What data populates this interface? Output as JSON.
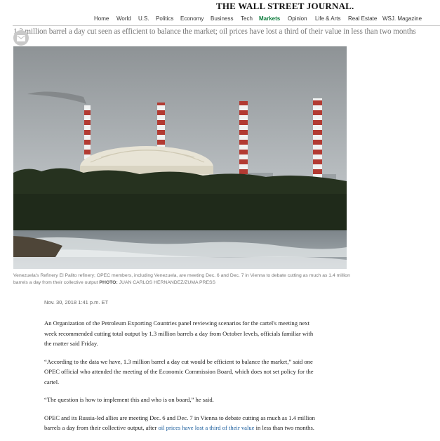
{
  "masthead": {
    "logo": "THE WALL STREET JOURNAL."
  },
  "nav": {
    "items": [
      "Home",
      "World",
      "U.S.",
      "Politics",
      "Economy",
      "Business",
      "Tech",
      "Markets",
      "Opinion",
      "Life & Arts",
      "Real Estate",
      "WSJ. Magazine"
    ],
    "active": "Markets"
  },
  "article": {
    "subheadline": "1.3 million barrel a day cut seen as efficient to balance the market; oil prices have lost a third of their value in less than two months",
    "caption": "Venezuela's Refinery El Palito refinery; OPEC members, including Venezuela, are meeting Dec. 6 and Dec. 7 in Vienna to debate cutting as much as 1.4 million barrels a day from their collective output",
    "credit_label": "PHOTO:",
    "credit": "JUAN CARLOS HERNANDEZ/ZUMA PRESS",
    "date": "Nov. 30, 2018 1:41 p.m. ET",
    "p1": "An Organization of the Petroleum Exporting Countries panel reviewing scenarios for the cartel's meeting next week recommended cutting total output by 1.3 million barrels a day from October levels, officials familiar with the matter said Friday.",
    "p2": "“According to the data we have, 1.3 million barrel a day cut would be efficient to balance the market,” said one OPEC official who attended the meeting of the Economic Commission Board, which does not set policy for the cartel.",
    "p3": "“The question is how to implement this and who is on board,” he said.",
    "p4_before": "OPEC and its Russia-led allies are meeting Dec. 6 and Dec. 7 in Vienna to debate cutting as much as 1.4 million barrels a day from their collective output, after ",
    "p4_link": "oil prices have lost a third of their value",
    "p4_after": " in less than two months."
  },
  "colors": {
    "active_nav": "#0a7a3a",
    "link": "#1a5d9c",
    "caption": "#777777"
  },
  "icons": {
    "share": "email-icon"
  }
}
